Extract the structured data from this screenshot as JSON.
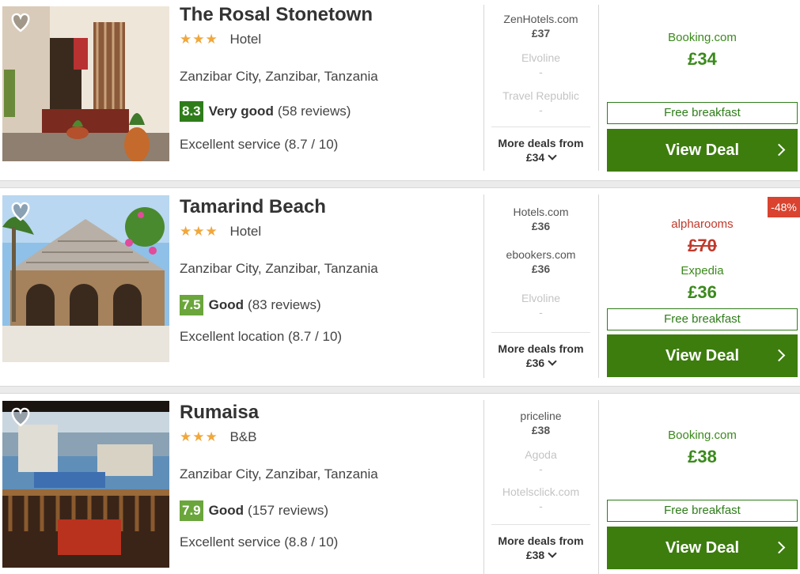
{
  "hotels": [
    {
      "name": "The Rosal Stonetown",
      "stars": "★★★",
      "type": "Hotel",
      "location": "Zanzibar City, Zanzibar, Tanzania",
      "score": "8.3",
      "rating_label": "Very good",
      "reviews": "(58 reviews)",
      "review_highlight": "Excellent service (8.7 / 10)",
      "deals": [
        {
          "provider": "ZenHotels.com",
          "price": "£37"
        },
        {
          "provider": "Elvoline",
          "price": "-"
        },
        {
          "provider": "Travel Republic",
          "price": "-"
        }
      ],
      "more_deals_label": "More deals from",
      "more_deals_price": "£34",
      "best_provider": "Booking.com",
      "best_price": "£34",
      "free_breakfast": "Free breakfast",
      "view_deal": "View Deal"
    },
    {
      "name": "Tamarind Beach",
      "stars": "★★★",
      "type": "Hotel",
      "location": "Zanzibar City, Zanzibar, Tanzania",
      "score": "7.5",
      "rating_label": "Good",
      "reviews": "(83 reviews)",
      "review_highlight": "Excellent location (8.7 / 10)",
      "deals": [
        {
          "provider": "Hotels.com",
          "price": "£36"
        },
        {
          "provider": "ebookers.com",
          "price": "£36"
        },
        {
          "provider": "Elvoline",
          "price": "-"
        }
      ],
      "more_deals_label": "More deals from",
      "more_deals_price": "£36",
      "discount_badge": "-48%",
      "strike_provider": "alpharooms",
      "strike_price": "£70",
      "best_provider": "Expedia",
      "best_price": "£36",
      "free_breakfast": "Free breakfast",
      "view_deal": "View Deal"
    },
    {
      "name": "Rumaisa",
      "stars": "★★★",
      "type": "B&B",
      "location": "Zanzibar City, Zanzibar, Tanzania",
      "score": "7.9",
      "rating_label": "Good",
      "reviews": "(157 reviews)",
      "review_highlight": "Excellent service (8.8 / 10)",
      "deals": [
        {
          "provider": "priceline",
          "price": "£38"
        },
        {
          "provider": "Agoda",
          "price": "-"
        },
        {
          "provider": "Hotelsclick.com",
          "price": "-"
        }
      ],
      "more_deals_label": "More deals from",
      "more_deals_price": "£38",
      "best_provider": "Booking.com",
      "best_price": "£38",
      "free_breakfast": "Free breakfast",
      "view_deal": "View Deal"
    }
  ],
  "colors": {
    "green_button": "#3d7d0e",
    "green_text": "#3b8a1c",
    "score_dark": "#2e7d1a",
    "score_light": "#6aa63b",
    "star": "#f0a73b",
    "discount": "#d9432f"
  }
}
